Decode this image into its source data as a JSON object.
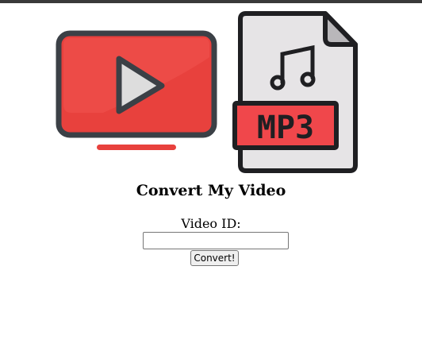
{
  "heading": "Convert My Video",
  "form": {
    "label": "Video ID:",
    "input_value": "",
    "button_label": "Convert!"
  },
  "banner": {
    "icons": [
      "video-player-icon",
      "mp3-file-icon"
    ],
    "mp3_badge_text": "MP3",
    "colors": {
      "red": "#e8413d",
      "red_light": "#f05350",
      "outline": "#3b4046",
      "paper": "#e6e4e6",
      "paper_fold": "#b9b7ba",
      "play_fill": "#dddddd"
    }
  }
}
